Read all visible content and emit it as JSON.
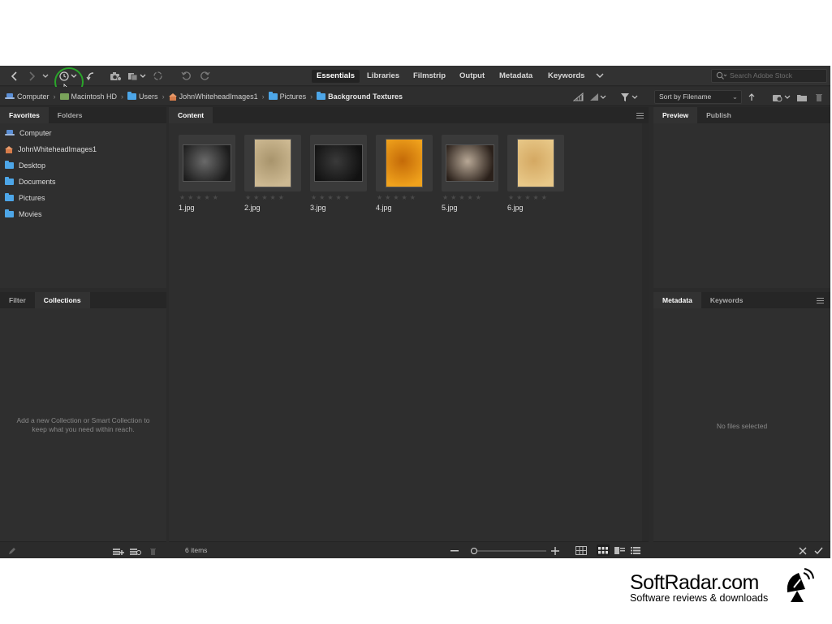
{
  "toolbar": {
    "workspaces": [
      "Essentials",
      "Libraries",
      "Filmstrip",
      "Output",
      "Metadata",
      "Keywords"
    ],
    "active_workspace": "Essentials",
    "search_placeholder": "Search Adobe Stock"
  },
  "path": {
    "crumbs": [
      {
        "label": "Computer",
        "icon": "computer-icon"
      },
      {
        "label": "Macintosh HD",
        "icon": "drive-icon"
      },
      {
        "label": "Users",
        "icon": "folder-icon"
      },
      {
        "label": "JohnWhiteheadImages1",
        "icon": "home-icon"
      },
      {
        "label": "Pictures",
        "icon": "folder-icon"
      },
      {
        "label": "Background Textures",
        "icon": "folder-icon"
      }
    ],
    "sort_label": "Sort by Filename"
  },
  "left_top": {
    "tabs": [
      "Favorites",
      "Folders"
    ],
    "items": [
      {
        "label": "Computer",
        "icon": "computer-icon"
      },
      {
        "label": "JohnWhiteheadImages1",
        "icon": "home-icon"
      },
      {
        "label": "Desktop",
        "icon": "folder-icon"
      },
      {
        "label": "Documents",
        "icon": "folder-icon"
      },
      {
        "label": "Pictures",
        "icon": "folder-icon"
      },
      {
        "label": "Movies",
        "icon": "folder-icon"
      }
    ]
  },
  "left_bottom": {
    "tabs": [
      "Filter",
      "Collections"
    ],
    "hint_line1": "Add a new Collection or Smart Collection to",
    "hint_line2": "keep what you need within reach."
  },
  "content": {
    "tab": "Content",
    "files": [
      {
        "name": "1.jpg",
        "colors": [
          "#1c1c1c",
          "#6a6a6a"
        ],
        "orientation": "landscape"
      },
      {
        "name": "2.jpg",
        "colors": [
          "#cdb992",
          "#a8946c"
        ],
        "orientation": "portrait"
      },
      {
        "name": "3.jpg",
        "colors": [
          "#111111",
          "#3a3a3a"
        ],
        "orientation": "landscape"
      },
      {
        "name": "4.jpg",
        "colors": [
          "#f0a21c",
          "#c46a08"
        ],
        "orientation": "portrait"
      },
      {
        "name": "5.jpg",
        "colors": [
          "#2a201a",
          "#b8a896"
        ],
        "orientation": "landscape"
      },
      {
        "name": "6.jpg",
        "colors": [
          "#e8c888",
          "#d4a862"
        ],
        "orientation": "portrait"
      }
    ],
    "item_count": "6 items"
  },
  "right_top": {
    "tabs": [
      "Preview",
      "Publish"
    ]
  },
  "right_bottom": {
    "tabs": [
      "Metadata",
      "Keywords"
    ],
    "empty_text": "No files selected"
  },
  "watermark": {
    "name": "SoftRadar.com",
    "tagline": "Software reviews & downloads"
  },
  "colors": {
    "accent_folder": "#4da6e8",
    "highlight_circle": "#2aa52a"
  }
}
